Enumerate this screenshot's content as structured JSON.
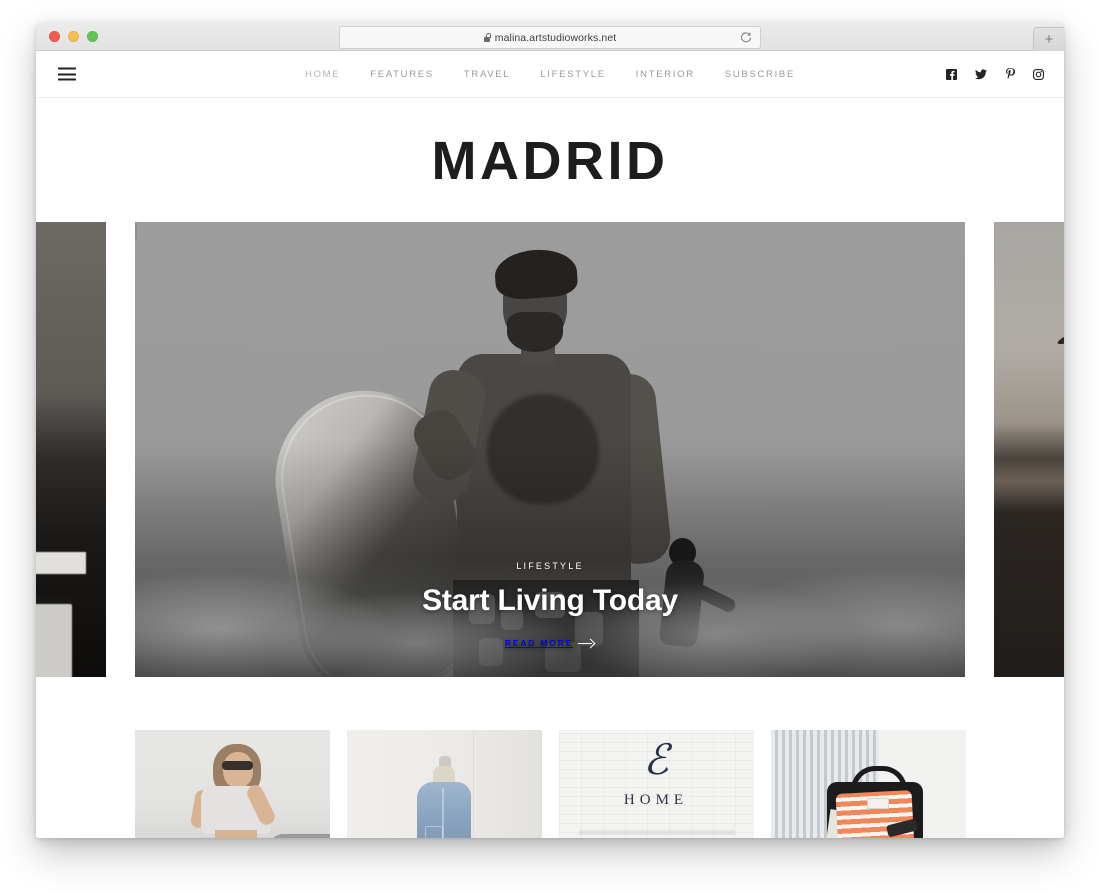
{
  "browser": {
    "url": "malina.artstudioworks.net",
    "lock_icon": "lock-icon",
    "reload_icon": "reload-icon",
    "new_tab_label": "+",
    "traffic_lights": [
      "close",
      "minimize",
      "maximize"
    ]
  },
  "site": {
    "title": "MADRID",
    "menu_icon": "hamburger-icon",
    "nav": [
      {
        "label": "HOME",
        "active": true
      },
      {
        "label": "FEATURES",
        "active": false
      },
      {
        "label": "TRAVEL",
        "active": false
      },
      {
        "label": "LIFESTYLE",
        "active": false
      },
      {
        "label": "INTERIOR",
        "active": false
      },
      {
        "label": "SUBSCRIBE",
        "active": false
      }
    ],
    "social": [
      {
        "name": "facebook-icon"
      },
      {
        "name": "twitter-icon"
      },
      {
        "name": "pinterest-icon"
      },
      {
        "name": "instagram-icon"
      }
    ]
  },
  "hero": {
    "category": "LIFESTYLE",
    "title": "Start Living Today",
    "read_more": "READ MORE",
    "arrow_icon": "arrow-right-icon",
    "image_alt": "black and white photo of a bearded surfer carrying a surfboard at the shoreline",
    "prev_slide_alt": "dark interior with white desk lamp, plant and drawers",
    "next_slide_alt": "palm tree silhouette against dusk sky"
  },
  "thumbnails": [
    {
      "alt": "woman in white knotted tee and sunglasses"
    },
    {
      "alt": "denim jacket hanging on a wall hook"
    },
    {
      "alt": "script monogram sign reading HOME on white brick wall",
      "monogram": "ℰ",
      "caption": "HOME"
    },
    {
      "alt": "orange striped shirt and black backpack against striped wall"
    }
  ],
  "colors": {
    "page_background": "#ffffff",
    "nav_text": "#9a9a9a",
    "title_text": "#1d1d1d",
    "hero_overlay_text": "#ffffff",
    "chrome_bar": "#e6e6e7"
  }
}
